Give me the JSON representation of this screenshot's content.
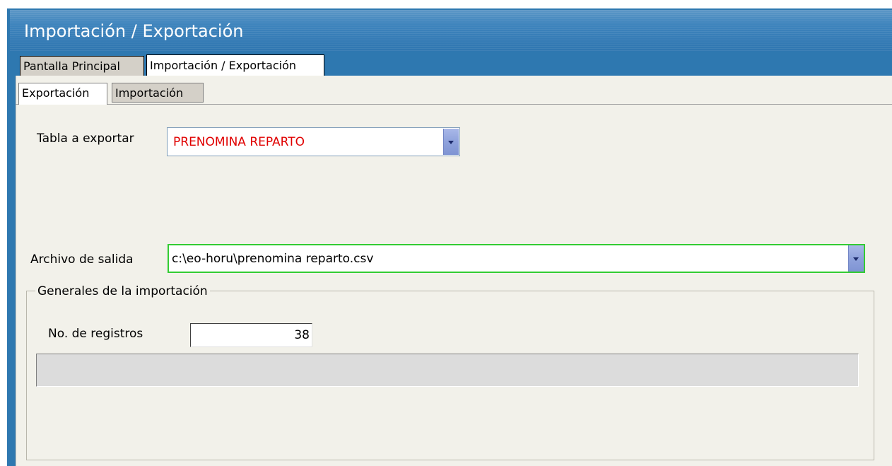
{
  "window": {
    "title": "Importación / Exportación"
  },
  "outer_tabs": [
    {
      "label": "Pantalla Principal",
      "active": false
    },
    {
      "label": "Importación / Exportación",
      "active": true
    }
  ],
  "inner_tabs": [
    {
      "label": "Exportación",
      "active": true
    },
    {
      "label": "Importación",
      "active": false
    }
  ],
  "export_form": {
    "table_label": "Tabla a exportar",
    "table_value": "PRENOMINA REPARTO",
    "table_value_color": "#e00000",
    "output_label": "Archivo de salida",
    "output_value": "c:\\eo-horu\\prenomina reparto.csv",
    "output_border_color": "#33cc33"
  },
  "general_group": {
    "title": "Generales de la importación",
    "records_label": "No. de registros",
    "records_value": "38",
    "progress_fraction": 0
  },
  "colors": {
    "title_bar": "#3e84bd",
    "content_bg": "#f2f1ea",
    "dropdown_button": "#8fa2dc"
  }
}
